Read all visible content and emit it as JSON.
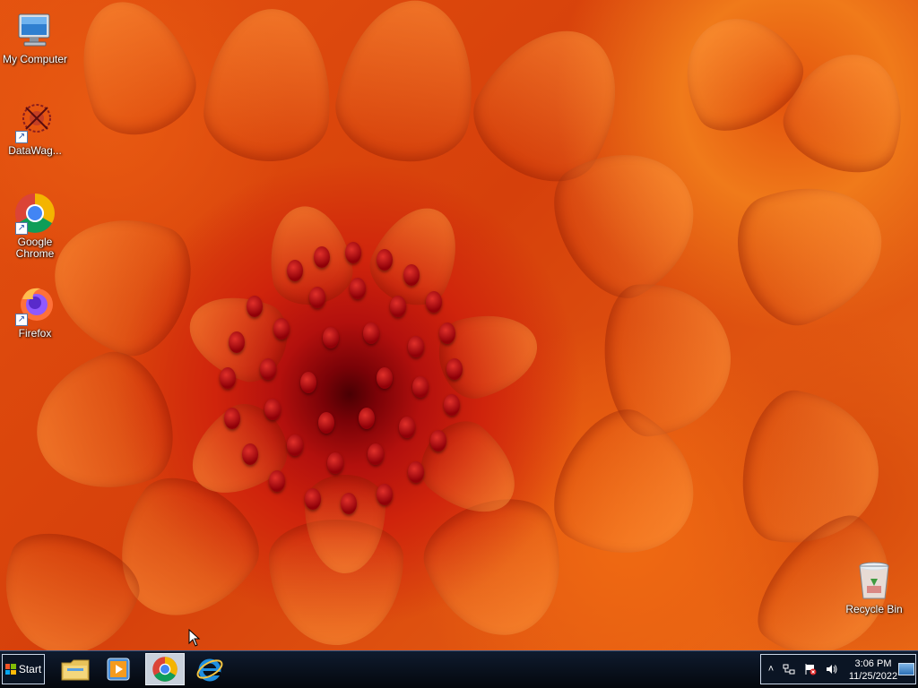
{
  "desktop": {
    "icons": [
      {
        "label": "My Computer"
      },
      {
        "label": "DataWag..."
      },
      {
        "label": "Google Chrome"
      },
      {
        "label": "Firefox"
      },
      {
        "label": "Recycle Bin"
      }
    ]
  },
  "taskbar": {
    "start_label": "Start",
    "pinned": [
      "file-explorer-icon",
      "media-player-icon",
      "chrome-icon",
      "internet-explorer-icon"
    ],
    "active_app": "chrome-icon"
  },
  "tray": {
    "time": "3:06 PM",
    "date": "11/25/2022"
  },
  "colors": {
    "taskbar": "#04070d",
    "accent": "#05a6f0"
  }
}
